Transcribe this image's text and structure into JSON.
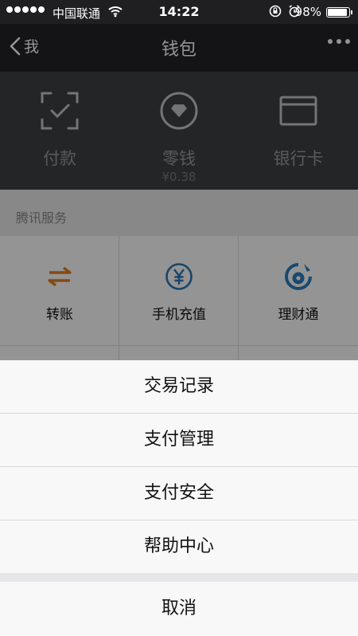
{
  "status_bar": {
    "carrier": "中国联通",
    "time": "14:22",
    "battery": "98%"
  },
  "nav": {
    "back_label": "我",
    "title": "钱包"
  },
  "wallet": {
    "items": [
      {
        "label": "付款",
        "icon": "scan-pay-icon"
      },
      {
        "label": "零钱",
        "amount": "¥0.38",
        "icon": "diamond-coin-icon"
      },
      {
        "label": "银行卡",
        "icon": "bank-card-icon"
      }
    ]
  },
  "services": {
    "title": "腾讯服务",
    "items": [
      {
        "label": "转账",
        "icon": "transfer-icon",
        "color": "#e5801d"
      },
      {
        "label": "手机充值",
        "icon": "yuan-circle-icon",
        "color": "#2b78b6"
      },
      {
        "label": "理财通",
        "icon": "licaitong-icon",
        "color": "#2a7fc2"
      }
    ]
  },
  "action_sheet": {
    "items": [
      {
        "label": "交易记录"
      },
      {
        "label": "支付管理"
      },
      {
        "label": "支付安全"
      },
      {
        "label": "帮助中心"
      }
    ],
    "cancel_label": "取消"
  },
  "colors": {
    "nav_bg": "#232326",
    "wallet_bg": "#3e4044",
    "transfer_orange": "#e5801d",
    "service_blue": "#2b78b6"
  }
}
